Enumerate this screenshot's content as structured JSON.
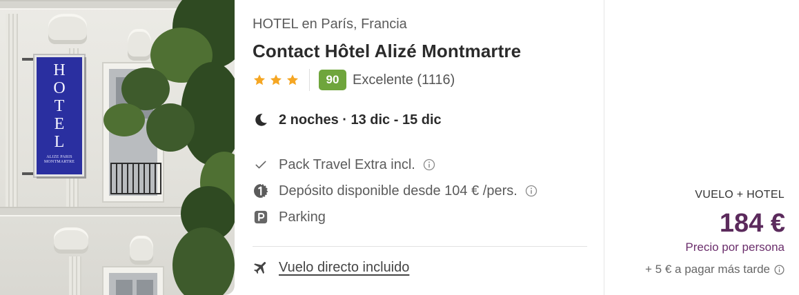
{
  "photo": {
    "sign_letters": [
      "H",
      "O",
      "T",
      "E",
      "L"
    ],
    "sign_subtitle": "ALIZE PARIS MONTMARTRE"
  },
  "hotel": {
    "type_location": "HOTEL en París, Francia",
    "name": "Contact Hôtel Alizé Montmartre",
    "stars": 3,
    "score": "90",
    "score_text": "Excelente (1116)"
  },
  "stay": {
    "text": "2 noches · 13 dic - 15 dic",
    "icon": "moon-icon"
  },
  "features": [
    {
      "icon": "check-icon",
      "text": "Pack Travel Extra incl.",
      "info": true
    },
    {
      "icon": "deposit-icon",
      "text": "Depósito disponible desde 104 € /pers.",
      "info": true
    },
    {
      "icon": "parking-icon",
      "text": "Parking",
      "info": false
    }
  ],
  "flight": {
    "icon": "plane-icon",
    "link_text": "Vuelo directo incluido"
  },
  "price": {
    "pack_label": "VUELO + HOTEL",
    "amount": "184 €",
    "per_person": "Precio por persona",
    "later": "+ 5 € a pagar más tarde"
  },
  "colors": {
    "score_badge": "#6fa53c",
    "star": "#f5a623",
    "price": "#5b2a5c",
    "sign_blue": "#2a2fa0"
  }
}
